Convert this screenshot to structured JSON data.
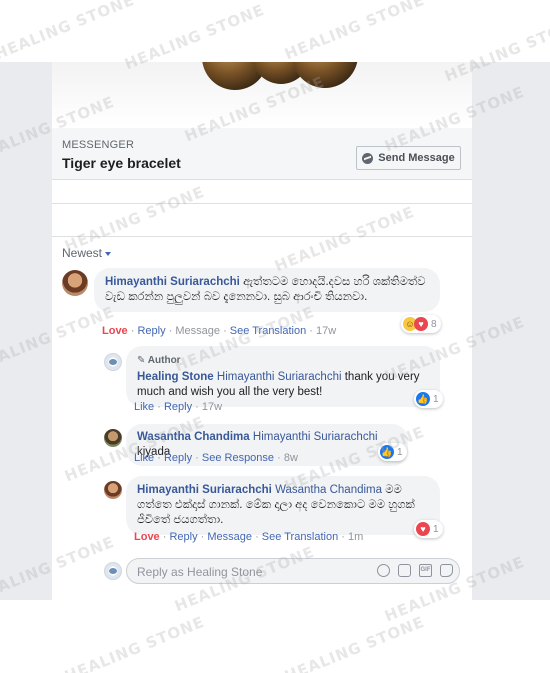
{
  "messenger": {
    "label": "MESSENGER",
    "title": "Tiger eye bracelet",
    "send_button": "Send Message"
  },
  "sort": {
    "label": "Newest"
  },
  "comments": [
    {
      "author": "Himayanthi Suriarachchi",
      "text": "ඇත්තටම හොදයි.දවස හරි ශක්තිමත්ව වැඩ කරන්න පුලුවන් බව දැනෙනවා. සුබ ආරංචි තියනවා.",
      "actions": {
        "love": "Love",
        "reply": "Reply",
        "message": "Message",
        "translate": "See Translation",
        "time": "17w"
      },
      "reaction_count": "8"
    },
    {
      "badge": "Author",
      "author": "Healing Stone",
      "tag": "Himayanthi Suriarachchi",
      "text": "thank you very much and wish you all the very best!",
      "actions": {
        "like": "Like",
        "reply": "Reply",
        "time": "17w"
      },
      "reaction_count": "1"
    },
    {
      "author": "Wasantha Chandima",
      "tag": "Himayanthi Suriarachchi",
      "text": "kiyada",
      "actions": {
        "like": "Like",
        "reply": "Reply",
        "response": "See Response",
        "time": "8w"
      },
      "reaction_count": "1"
    },
    {
      "author": "Himayanthi Suriarachchi",
      "tag": "Wasantha Chandima",
      "text": "මම ගත්තෙ එක්දාස් ගානක්. මේක දාලා අද වෙනකොට මම හුගක් ජීවිතේ ජයගත්තා.",
      "actions": {
        "love": "Love",
        "reply": "Reply",
        "message": "Message",
        "translate": "See Translation",
        "time": "1m"
      },
      "reaction_count": "1"
    }
  ],
  "reply_box": {
    "placeholder": "Reply as Healing Stone"
  },
  "watermark": "HEALING STONE",
  "colors": {
    "link": "#385898",
    "love": "#e9464f",
    "like": "#1877f2",
    "bubble": "#f2f3f5"
  }
}
